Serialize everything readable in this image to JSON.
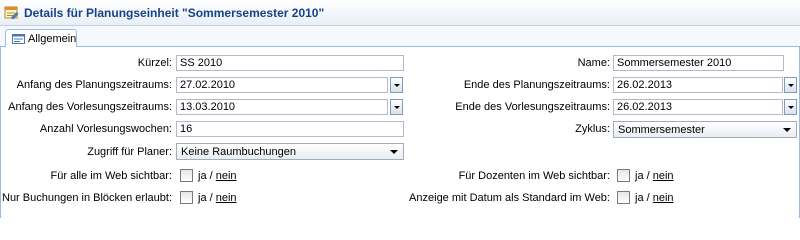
{
  "window": {
    "title": "Details für Planungseinheit \"Sommersemester 2010\""
  },
  "tabs": [
    {
      "label": "Allgemein"
    }
  ],
  "form": {
    "kuerzel": {
      "label": "Kürzel:",
      "value": "SS 2010"
    },
    "name": {
      "label": "Name:",
      "value": "Sommersemester 2010"
    },
    "anfang_planung": {
      "label": "Anfang des Planungszeitraums:",
      "value": "27.02.2010"
    },
    "ende_planung": {
      "label": "Ende des Planungszeitraums:",
      "value": "26.02.2013"
    },
    "anfang_vorlesung": {
      "label": "Anfang des Vorlesungszeitraums:",
      "value": "13.03.2010"
    },
    "ende_vorlesung": {
      "label": "Ende des Vorlesungszeitraums:",
      "value": "26.02.2013"
    },
    "anzahl_wochen": {
      "label": "Anzahl Vorlesungswochen:",
      "value": "16"
    },
    "zyklus": {
      "label": "Zyklus:",
      "value": "Sommersemester"
    },
    "zugriff": {
      "label": "Zugriff für Planer:",
      "value": "Keine Raumbuchungen"
    },
    "web_alle": {
      "label": "Für alle im Web sichtbar:",
      "checked": false
    },
    "web_dozenten": {
      "label": "Für Dozenten im Web sichtbar:",
      "checked": false
    },
    "bloecke": {
      "label": "Nur Buchungen in Blöcken erlaubt:",
      "checked": false
    },
    "datum_standard": {
      "label": "Anzeige mit Datum als Standard im Web:",
      "checked": false
    },
    "yes_label": "ja",
    "separator": "/",
    "no_label": "nein"
  },
  "icons": {
    "title": "calendar-edit-icon",
    "tab": "form-tab-icon"
  },
  "colors": {
    "title": "#15428b",
    "border": "#99bbe8"
  }
}
